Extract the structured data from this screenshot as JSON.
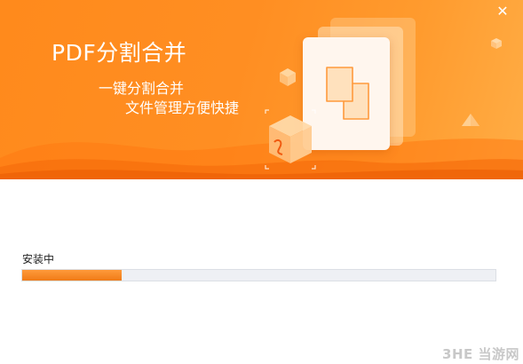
{
  "window": {
    "close_glyph": "✕",
    "accent_color": "#ff8a1c"
  },
  "banner": {
    "title": "PDF分割合并",
    "subtitle_line1": "一键分割合并",
    "subtitle_line2": "文件管理方便快捷",
    "illustration_icons": [
      "split-document-icon",
      "pdf-cube-icon"
    ]
  },
  "install": {
    "status_text": "安装中",
    "progress_percent": 21
  },
  "watermark": {
    "text": "3HE 当游网"
  }
}
